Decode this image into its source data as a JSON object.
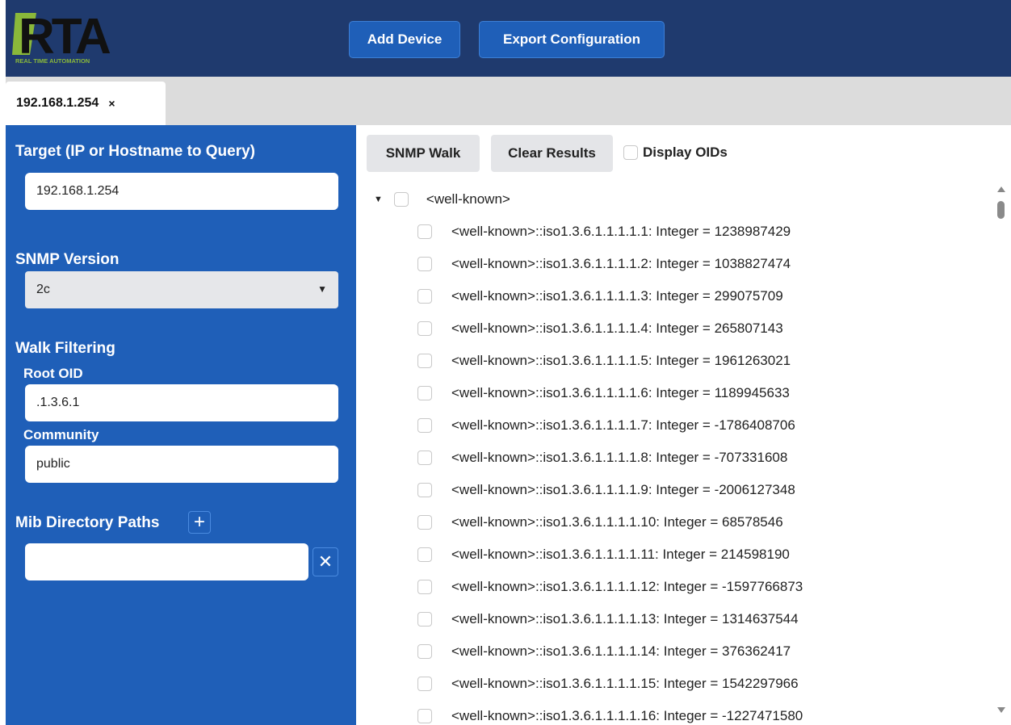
{
  "header": {
    "logo_text": "RTA",
    "logo_tagline": "REAL TIME AUTOMATION",
    "add_device": "Add Device",
    "export_configuration": "Export Configuration"
  },
  "tabs": [
    {
      "label": "192.168.1.254",
      "close": "×"
    }
  ],
  "sidebar": {
    "target_label": "Target (IP or Hostname to Query)",
    "target_value": "192.168.1.254",
    "snmp_version_label": "SNMP Version",
    "snmp_version_value": "2c",
    "walk_filtering_label": "Walk Filtering",
    "root_oid_label": "Root OID",
    "root_oid_value": ".1.3.6.1",
    "community_label": "Community",
    "community_value": "public",
    "mib_paths_label": "Mib Directory Paths",
    "mib_path_value": ""
  },
  "main": {
    "snmp_walk": "SNMP Walk",
    "clear_results": "Clear Results",
    "display_oids": "Display OIDs",
    "tree_root": "<well-known>",
    "rows": [
      "<well-known>::iso1.3.6.1.1.1.1.1: Integer = 1238987429",
      "<well-known>::iso1.3.6.1.1.1.1.2: Integer = 1038827474",
      "<well-known>::iso1.3.6.1.1.1.1.3: Integer = 299075709",
      "<well-known>::iso1.3.6.1.1.1.1.4: Integer = 265807143",
      "<well-known>::iso1.3.6.1.1.1.1.5: Integer = 1961263021",
      "<well-known>::iso1.3.6.1.1.1.1.6: Integer = 1189945633",
      "<well-known>::iso1.3.6.1.1.1.1.7: Integer = -1786408706",
      "<well-known>::iso1.3.6.1.1.1.1.8: Integer = -707331608",
      "<well-known>::iso1.3.6.1.1.1.1.9: Integer = -2006127348",
      "<well-known>::iso1.3.6.1.1.1.1.10: Integer = 68578546",
      "<well-known>::iso1.3.6.1.1.1.1.11: Integer = 214598190",
      "<well-known>::iso1.3.6.1.1.1.1.12: Integer = -1597766873",
      "<well-known>::iso1.3.6.1.1.1.1.13: Integer = 1314637544",
      "<well-known>::iso1.3.6.1.1.1.1.14: Integer = 376362417",
      "<well-known>::iso1.3.6.1.1.1.1.15: Integer = 1542297966",
      "<well-known>::iso1.3.6.1.1.1.1.16: Integer = -1227471580"
    ]
  },
  "colors": {
    "header_bg": "#1f3a6e",
    "accent_blue": "#1f5fb8",
    "logo_green": "#8ab83a"
  },
  "icons": {
    "tab_close": "close-icon",
    "select_caret": "chevron-down-icon",
    "add_path": "plus-icon",
    "remove_path": "close-icon",
    "tree_expand": "caret-down-icon"
  }
}
